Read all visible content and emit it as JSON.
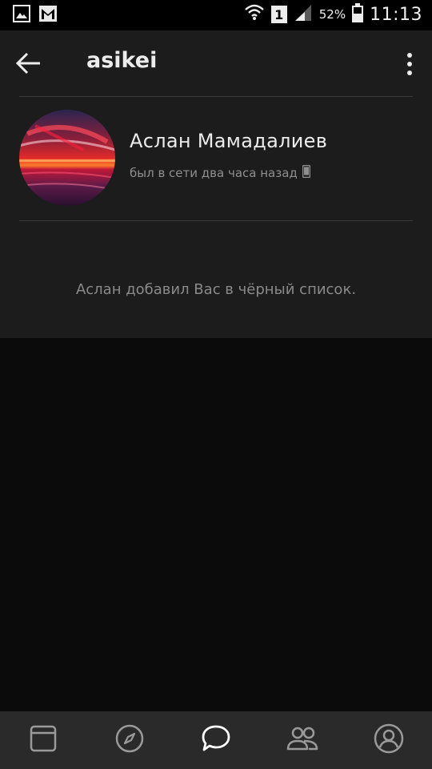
{
  "status_bar": {
    "battery_percent": "52%",
    "time": "11:13",
    "sim_slot": "1",
    "icons": [
      "gallery-icon",
      "gmail-icon",
      "wifi-icon",
      "sim-icon",
      "signal-icon",
      "battery-icon"
    ]
  },
  "appbar": {
    "title": "asikei",
    "back_icon": "arrow-left-icon",
    "menu_icon": "more-vertical-icon"
  },
  "profile": {
    "name": "Аслан Мамадалиев",
    "last_seen": "был в сети два часа назад",
    "device_icon": "phone-icon"
  },
  "notice": "Аслан добавил Вас в чёрный список.",
  "bottom_nav": {
    "items": [
      {
        "icon": "news-icon",
        "active": false
      },
      {
        "icon": "explore-icon",
        "active": false
      },
      {
        "icon": "messages-icon",
        "active": true
      },
      {
        "icon": "friends-icon",
        "active": false
      },
      {
        "icon": "profile-icon",
        "active": false
      }
    ]
  },
  "colors": {
    "background": "#0b0b0b",
    "surface": "#1c1c1c",
    "nav": "#2a2a2a",
    "text_primary": "#ececec",
    "text_secondary": "#8f8f8f",
    "icon_inactive": "#9a9a9a",
    "icon_active": "#ffffff"
  }
}
